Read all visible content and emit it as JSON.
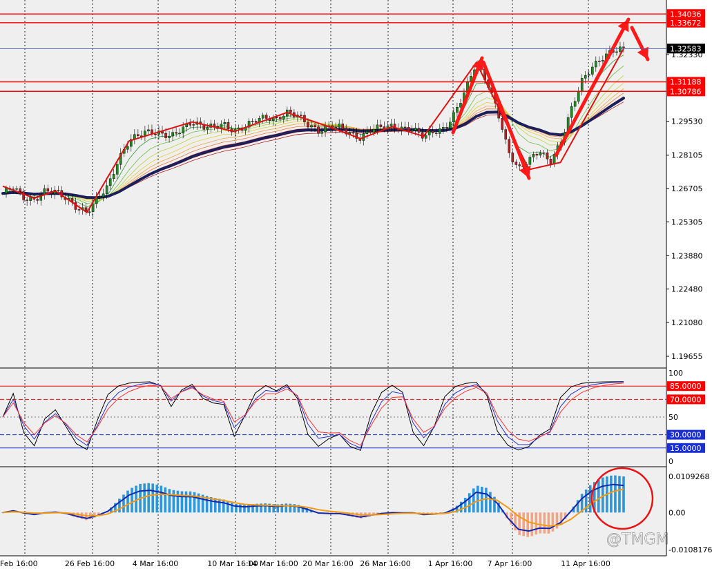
{
  "colors": {
    "bg": "#efefef",
    "up": "#1f8a1f",
    "down": "#b22222",
    "ma": "#1b1f5a",
    "level": "#ff0000",
    "hist_pos": "#2f95d8",
    "hist_neg": "#f4a386",
    "macd": "#1228b0",
    "signal": "#f29a12",
    "stoch_k": "#000000",
    "stoch_d1": "#2233cc",
    "stoch_d2": "#ff3333"
  },
  "watermark": "@TMGM",
  "chart_data": [
    {
      "type": "candlestick",
      "pane": "price",
      "symbol": "",
      "ylim": [
        1.1925,
        1.3445
      ],
      "y_ticks": [
        "1.32330",
        "1.29530",
        "1.28105",
        "1.26705",
        "1.25305",
        "1.23880",
        "1.22480",
        "1.21080",
        "1.19655"
      ],
      "x_labels": [
        "Feb 16:00",
        "26 Feb 16:00",
        "4 Mar 16:00",
        "10 Mar 16:00",
        "14 Mar 16:00",
        "20 Mar 16:00",
        "26 Mar 16:00",
        "1 Apr 16:00",
        "7 Apr 16:00",
        "11 Apr 16:00"
      ],
      "close_path": [
        1.265,
        1.268,
        1.263,
        1.262,
        1.266,
        1.266,
        1.263,
        1.259,
        1.257,
        1.263,
        1.268,
        1.279,
        1.287,
        1.29,
        1.291,
        1.29,
        1.289,
        1.292,
        1.295,
        1.293,
        1.293,
        1.294,
        1.291,
        1.293,
        1.296,
        1.297,
        1.296,
        1.299,
        1.298,
        1.294,
        1.291,
        1.293,
        1.293,
        1.29,
        1.288,
        1.292,
        1.293,
        1.293,
        1.292,
        1.292,
        1.289,
        1.291,
        1.292,
        1.299,
        1.309,
        1.32,
        1.312,
        1.3,
        1.283,
        1.275,
        1.279,
        1.283,
        1.278,
        1.286,
        1.3,
        1.312,
        1.318,
        1.322,
        1.325,
        1.3258
      ],
      "levels": [
        {
          "label": "1.34036",
          "value": 1.34036
        },
        {
          "label": "1.33672",
          "value": 1.33672
        },
        {
          "label": "1.32583",
          "value": 1.32583
        },
        {
          "label": "1.31188",
          "value": 1.31188
        },
        {
          "label": "1.30786",
          "value": 1.30786
        }
      ]
    },
    {
      "type": "line",
      "pane": "stochastic",
      "ylim": [
        0,
        100
      ],
      "y_ticks": [
        "100",
        "50",
        "0"
      ],
      "levels": [
        {
          "label": "85.0000",
          "value": 85
        },
        {
          "label": "70.0000",
          "value": 70
        },
        {
          "label": "30.0000",
          "value": 30
        },
        {
          "label": "15.0000",
          "value": 15
        }
      ]
    },
    {
      "type": "bar",
      "pane": "macd",
      "y_ticks": [
        "0.0109268",
        "0.00",
        "-0.0108176"
      ],
      "ylim": [
        -0.0108176,
        0.0109268
      ]
    }
  ]
}
